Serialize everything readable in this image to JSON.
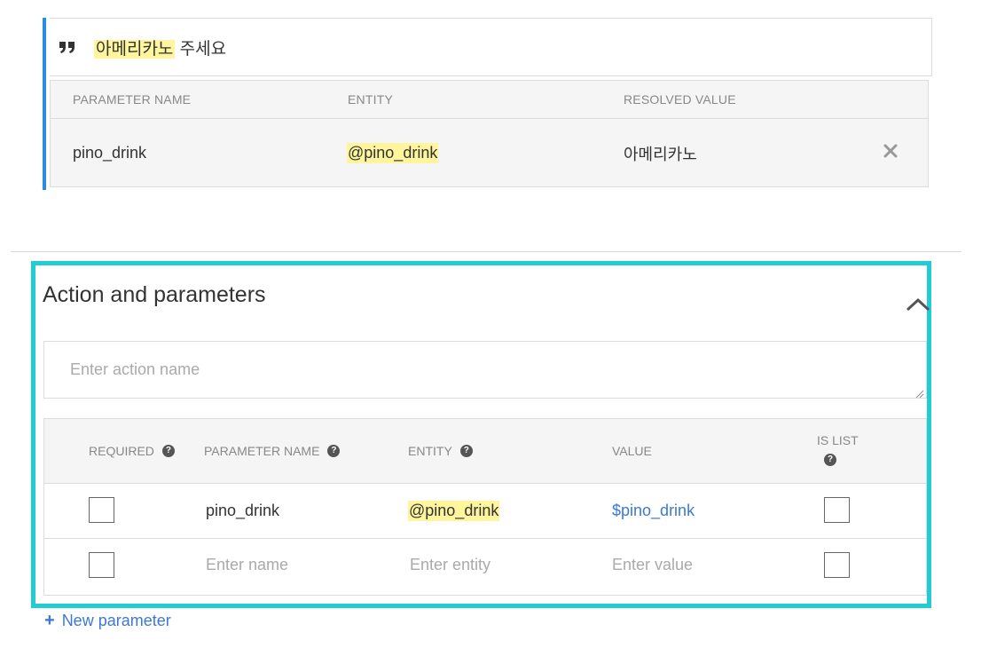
{
  "training_phrase": {
    "highlighted_text": "아메리카노",
    "rest_text": " 주세요",
    "resolution_table": {
      "headers": [
        "PARAMETER NAME",
        "ENTITY",
        "RESOLVED VALUE"
      ],
      "row": {
        "parameter_name": "pino_drink",
        "entity": "@pino_drink",
        "resolved_value": "아메리카노"
      }
    }
  },
  "action_section": {
    "title": "Action and parameters",
    "action_name_placeholder": "Enter action name",
    "table": {
      "headers": {
        "required": "REQUIRED",
        "parameter_name": "PARAMETER NAME",
        "entity": "ENTITY",
        "value": "VALUE",
        "is_list": "IS LIST"
      },
      "rows": [
        {
          "required": false,
          "parameter_name": "pino_drink",
          "entity": "@pino_drink",
          "value": "$pino_drink",
          "is_list": false
        }
      ],
      "empty_row": {
        "name_placeholder": "Enter name",
        "entity_placeholder": "Enter entity",
        "value_placeholder": "Enter value"
      }
    },
    "new_parameter_label": "New parameter"
  },
  "colors": {
    "accent_blue": "#2b8be0",
    "highlight_yellow": "#fff59d",
    "focus_cyan": "#22ccd6",
    "link_blue": "#3b78d8"
  },
  "icons": [
    "quote-icon",
    "close-icon",
    "chevron-up-icon",
    "help-icon",
    "plus-icon",
    "resize-grip-icon"
  ]
}
